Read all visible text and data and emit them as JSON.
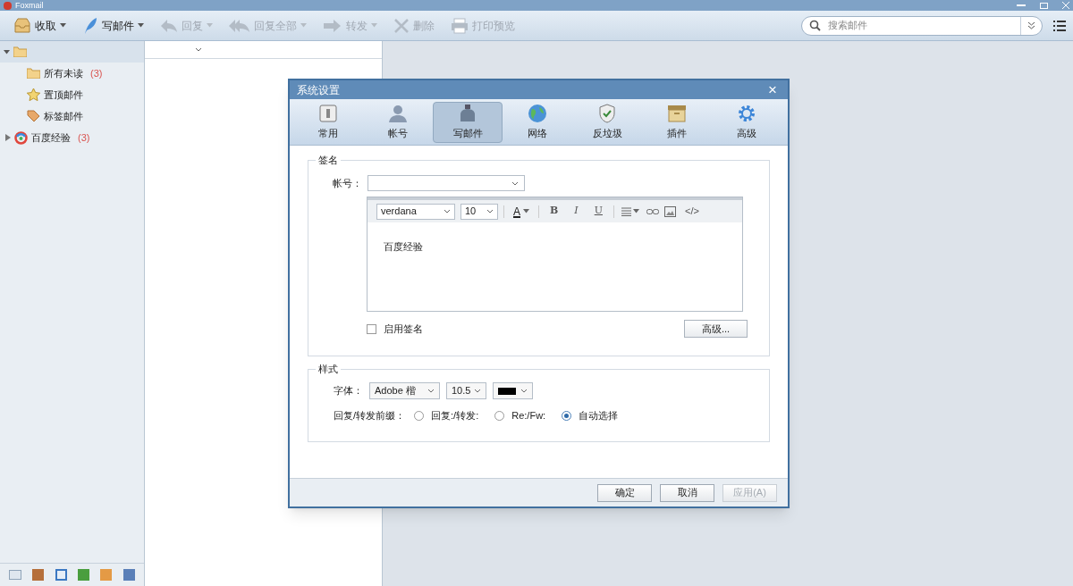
{
  "window": {
    "title": "Foxmail"
  },
  "toolbar": [
    {
      "label": "收取",
      "kind": "inbox",
      "dropdown": true,
      "disabled": false
    },
    {
      "label": "写邮件",
      "kind": "compose",
      "dropdown": true,
      "disabled": false
    },
    {
      "label": "回复",
      "kind": "reply",
      "dropdown": true,
      "disabled": true
    },
    {
      "label": "回复全部",
      "kind": "replyall",
      "dropdown": true,
      "disabled": true
    },
    {
      "label": "转发",
      "kind": "forward",
      "dropdown": true,
      "disabled": true
    },
    {
      "label": "删除",
      "kind": "delete",
      "dropdown": false,
      "disabled": true
    },
    {
      "label": "打印预览",
      "kind": "print",
      "dropdown": false,
      "disabled": true
    }
  ],
  "search": {
    "placeholder": "搜索邮件"
  },
  "sidebar": {
    "items": [
      {
        "label": "所有未读",
        "count": "(3)",
        "kind": "folder"
      },
      {
        "label": "置顶邮件",
        "kind": "star"
      },
      {
        "label": "标签邮件",
        "kind": "tag"
      },
      {
        "label": "百度经验",
        "count": "(3)",
        "kind": "account",
        "expanded": false
      }
    ]
  },
  "dialog": {
    "title": "系统设置",
    "close": "×",
    "tabs": [
      {
        "label": "常用",
        "kind": "general",
        "selected": false
      },
      {
        "label": "帐号",
        "kind": "account",
        "selected": false
      },
      {
        "label": "写邮件",
        "kind": "compose",
        "selected": true
      },
      {
        "label": "网络",
        "kind": "network",
        "selected": false
      },
      {
        "label": "反垃圾",
        "kind": "spam",
        "selected": false
      },
      {
        "label": "插件",
        "kind": "plugin",
        "selected": false
      },
      {
        "label": "高级",
        "kind": "advanced",
        "selected": false
      }
    ],
    "signature": {
      "legend": "签名",
      "account_label": "帐号：",
      "editor": {
        "font": "verdana",
        "size": "10",
        "color_letter": "A",
        "format_buttons": [
          "B",
          "I",
          "U"
        ],
        "code_button": "</>",
        "content": "百度经验"
      },
      "enable": {
        "label": "启用签名",
        "checked": false
      },
      "advanced_button": "高级..."
    },
    "style": {
      "legend": "样式",
      "font_label": "字体：",
      "font": "Adobe 楷",
      "size": "10.5",
      "color": "#000000",
      "prefix_label": "回复/转发前缀：",
      "prefix_options": [
        {
          "label": "回复:/转发:",
          "selected": false
        },
        {
          "label": "Re:/Fw:",
          "selected": false
        },
        {
          "label": "自动选择",
          "selected": true
        }
      ]
    },
    "buttons": [
      {
        "label": "确定",
        "disabled": false
      },
      {
        "label": "取消",
        "disabled": false
      },
      {
        "label": "应用(A)",
        "disabled": true
      }
    ]
  }
}
